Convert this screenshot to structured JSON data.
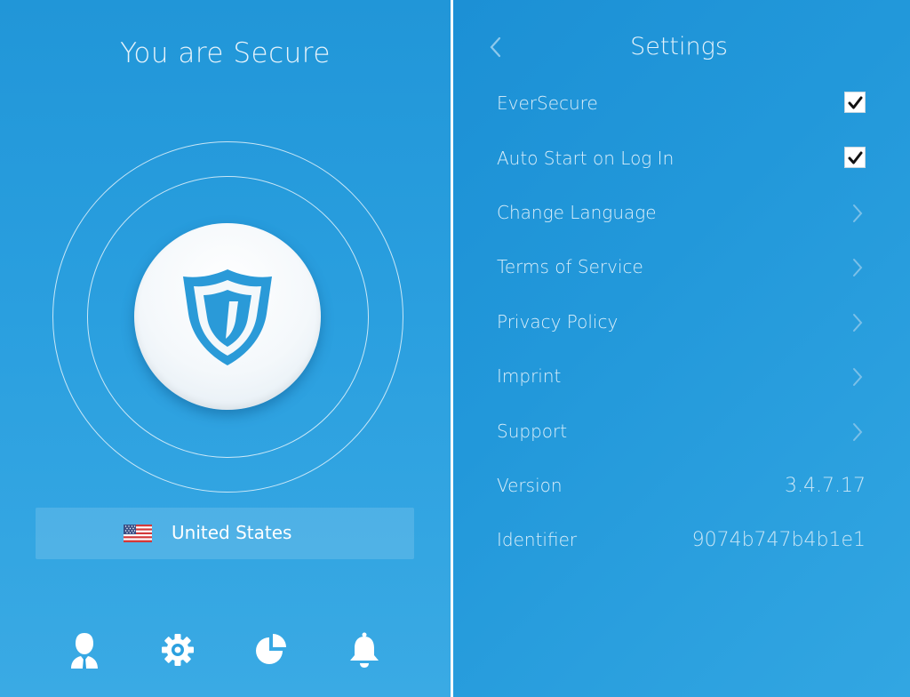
{
  "left": {
    "title": "You are Secure",
    "location": {
      "country": "United States",
      "flag": "us-flag-icon"
    },
    "connect_icon": "shield-icon",
    "nav": [
      {
        "icon": "user-icon"
      },
      {
        "icon": "gear-icon"
      },
      {
        "icon": "pie-chart-icon"
      },
      {
        "icon": "bell-icon"
      }
    ]
  },
  "right": {
    "title": "Settings",
    "back_icon": "chevron-left-icon",
    "rows": [
      {
        "label": "EverSecure",
        "control": "checkbox",
        "checked": true
      },
      {
        "label": "Auto Start on Log In",
        "control": "checkbox",
        "checked": true
      },
      {
        "label": "Change Language",
        "control": "chevron"
      },
      {
        "label": "Terms of Service",
        "control": "chevron"
      },
      {
        "label": "Privacy Policy",
        "control": "chevron"
      },
      {
        "label": "Imprint",
        "control": "chevron"
      },
      {
        "label": "Support",
        "control": "chevron"
      },
      {
        "label": "Version",
        "control": "value",
        "value": "3.4.7.17"
      },
      {
        "label": "Identifier",
        "control": "value",
        "value": "9074b747b4b1e1"
      }
    ]
  },
  "colors": {
    "background_blue": "#2298da",
    "shield_blue": "#2a9ad8",
    "text_light": "#dceffa"
  }
}
